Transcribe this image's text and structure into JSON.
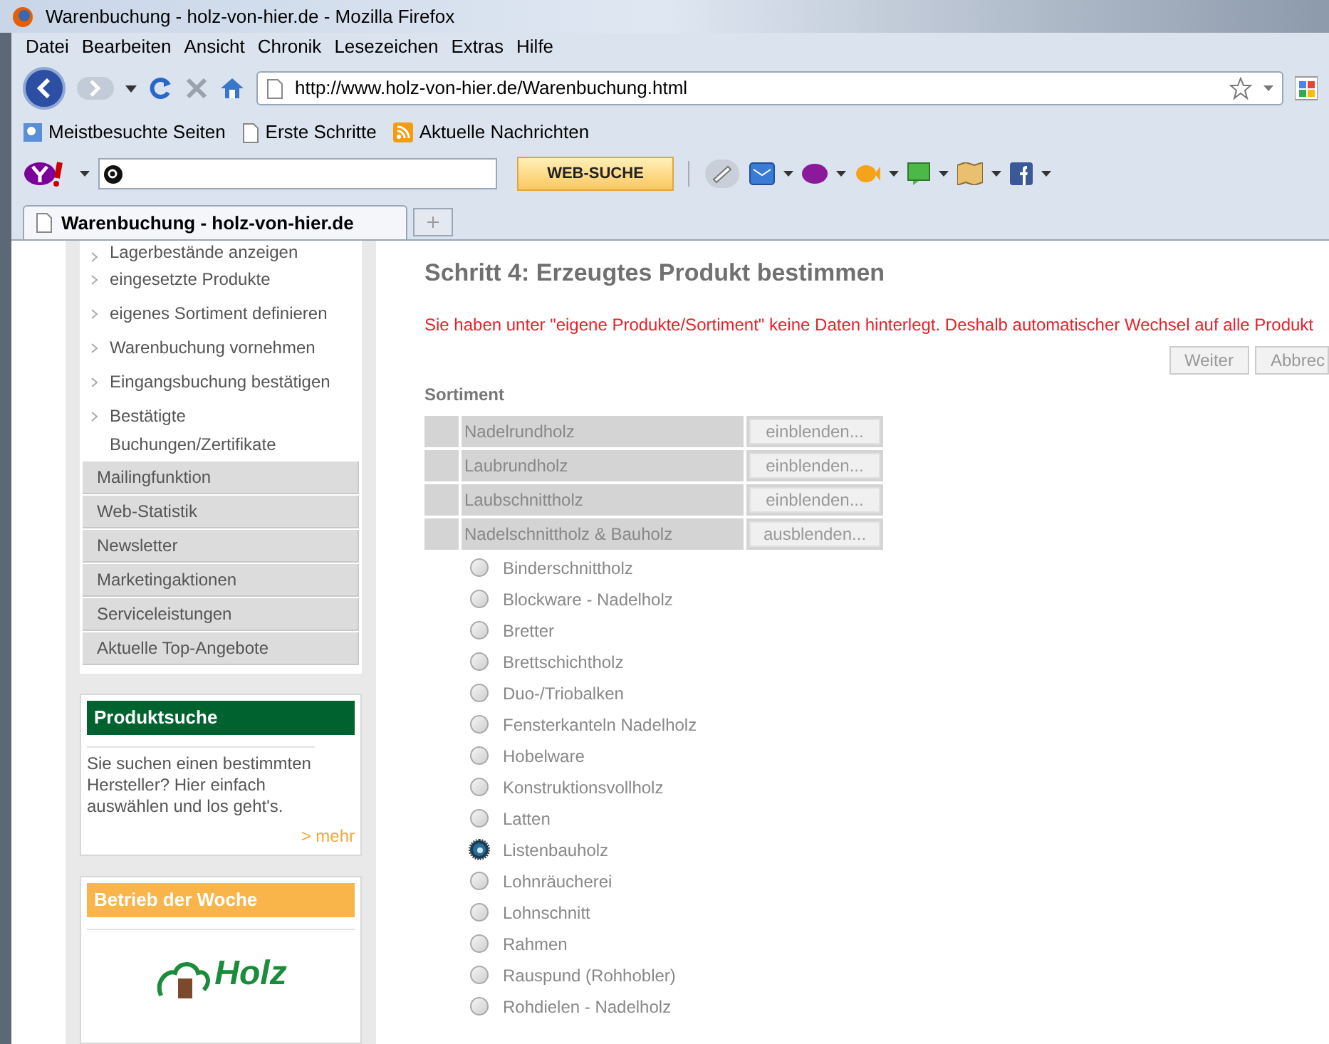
{
  "window": {
    "title": "Warenbuchung - holz-von-hier.de - Mozilla Firefox"
  },
  "menu": [
    "Datei",
    "Bearbeiten",
    "Ansicht",
    "Chronik",
    "Lesezeichen",
    "Extras",
    "Hilfe"
  ],
  "address": {
    "url": "http://www.holz-von-hier.de/Warenbuchung.html"
  },
  "bookmarks": [
    {
      "label": "Meistbesuchte Seiten",
      "kind": "search"
    },
    {
      "label": "Erste Schritte",
      "kind": "page"
    },
    {
      "label": "Aktuelle Nachrichten",
      "kind": "feed"
    }
  ],
  "yahoo_toolbar": {
    "search_button": "WEB-SUCHE"
  },
  "tabs": [
    {
      "label": "Warenbuchung - holz-von-hier.de",
      "selected": true
    }
  ],
  "sidebar": {
    "links": [
      "Lagerbestände anzeigen",
      "eingesetzte Produkte",
      "eigenes Sortiment definieren",
      "Warenbuchung vornehmen",
      "Eingangsbuchung bestätigen",
      "Bestätigte Buchungen/Zertifikate"
    ],
    "menu": [
      "Mailingfunktion",
      "Web-Statistik",
      "Newsletter",
      "Marketingaktionen",
      "Serviceleistungen",
      "Aktuelle Top-Angebote"
    ],
    "boxes": [
      {
        "title": "Produktsuche",
        "color": "#00632f",
        "text": "Sie suchen einen bestimmten Hersteller? Hier einfach auswählen und los geht's.",
        "link": "> mehr"
      },
      {
        "title": "Betrieb der Woche",
        "color": "#f9b54a",
        "logo": "Holz"
      }
    ]
  },
  "main": {
    "heading": "Schritt 4: Erzeugtes Produkt bestimmen",
    "notice": "Sie haben unter \"eigene Produkte/Sortiment\" keine Daten hinterlegt. Deshalb automatischer Wechsel auf alle Produkt",
    "buttons": [
      "Weiter",
      "Abbrec"
    ],
    "section": "Sortiment",
    "categories": [
      {
        "label": "Nadelrundholz",
        "toggle": "einblenden..."
      },
      {
        "label": "Laubrundholz",
        "toggle": "einblenden..."
      },
      {
        "label": "Laubschnittholz",
        "toggle": "einblenden..."
      },
      {
        "label": "Nadelschnittholz & Bauholz",
        "toggle": "ausblenden..."
      }
    ],
    "options": [
      {
        "label": "Binderschnittholz",
        "selected": false
      },
      {
        "label": "Blockware - Nadelholz",
        "selected": false
      },
      {
        "label": "Bretter",
        "selected": false
      },
      {
        "label": "Brettschichtholz",
        "selected": false
      },
      {
        "label": "Duo-/Triobalken",
        "selected": false
      },
      {
        "label": "Fensterkanteln Nadelholz",
        "selected": false
      },
      {
        "label": "Hobelware",
        "selected": false
      },
      {
        "label": "Konstruktionsvollholz",
        "selected": false
      },
      {
        "label": "Latten",
        "selected": false
      },
      {
        "label": "Listenbauholz",
        "selected": true
      },
      {
        "label": "Lohnräucherei",
        "selected": false
      },
      {
        "label": "Lohnschnitt",
        "selected": false
      },
      {
        "label": "Rahmen",
        "selected": false
      },
      {
        "label": "Rauspund (Rohhobler)",
        "selected": false
      },
      {
        "label": "Rohdielen - Nadelholz",
        "selected": false
      }
    ]
  }
}
